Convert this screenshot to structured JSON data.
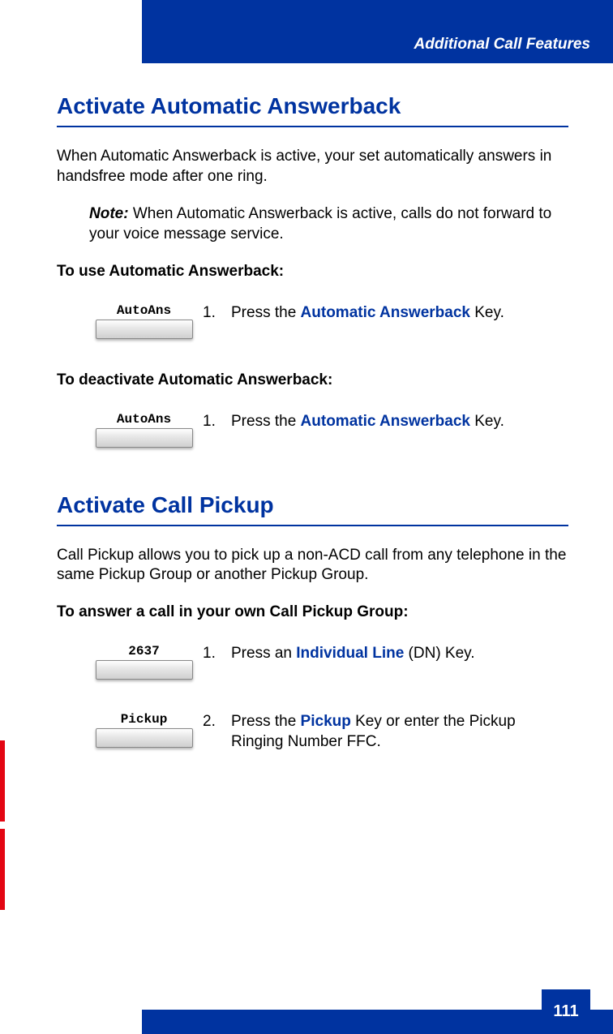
{
  "header": {
    "title": "Additional Call Features"
  },
  "section1": {
    "heading": "Activate Automatic Answerback",
    "intro": "When Automatic Answerback is active, your set automatically answers in handsfree mode after one ring.",
    "note_label": "Note:",
    "note_text": " When Automatic Answerback is active, calls do not forward to your voice message service.",
    "use_heading": "To use Automatic Answerback:",
    "use_step": {
      "key_label": "AutoAns",
      "num": "1.",
      "pre": "Press the ",
      "key_name": "Automatic Answerback",
      "post": " Key."
    },
    "deact_heading": "To deactivate Automatic Answerback:",
    "deact_step": {
      "key_label": "AutoAns",
      "num": "1.",
      "pre": "Press the ",
      "key_name": "Automatic Answerback",
      "post": " Key."
    }
  },
  "section2": {
    "heading": "Activate Call Pickup",
    "intro": "Call Pickup allows you to pick up a non-ACD call from any telephone in the same Pickup Group or another Pickup Group.",
    "answer_heading": "To answer a call in your own Call Pickup Group:",
    "step1": {
      "key_label": "2637",
      "num": "1.",
      "pre": "Press an ",
      "key_name": "Individual Line",
      "post": " (DN) Key."
    },
    "step2": {
      "key_label": "Pickup",
      "num": "2.",
      "pre": "Press the ",
      "key_name": "Pickup",
      "post": " Key or enter the Pickup Ringing Number FFC."
    }
  },
  "page_number": "111"
}
